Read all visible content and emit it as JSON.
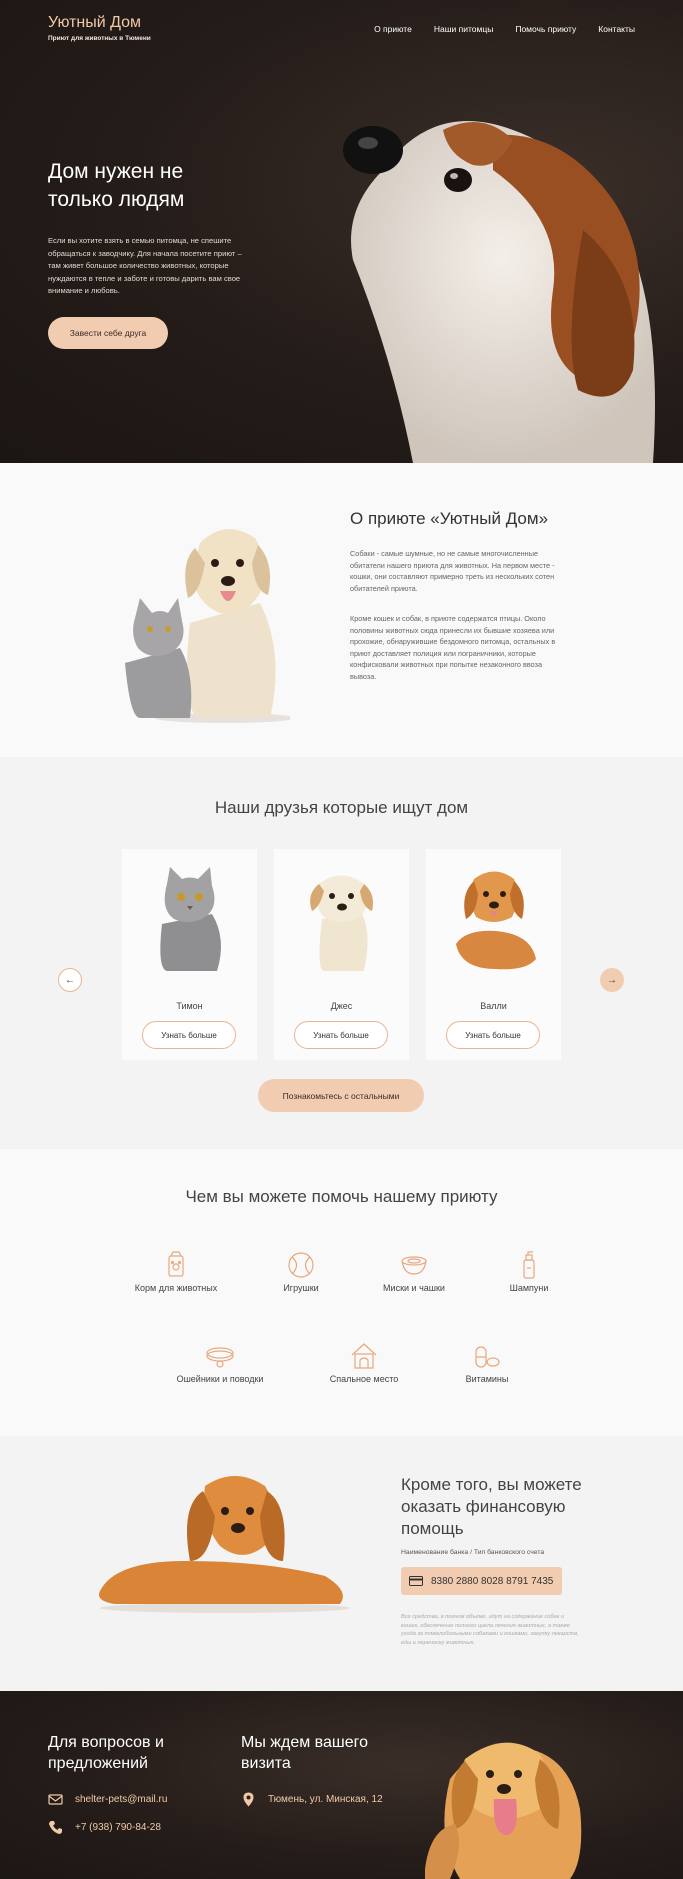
{
  "header": {
    "logo_title": "Уютный Дом",
    "logo_subtitle": "Приют для животных в Тюмени",
    "nav": [
      "О приюте",
      "Наши питомцы",
      "Помочь приюту",
      "Контакты"
    ]
  },
  "hero": {
    "title": "Дом нужен не только людям",
    "text": "Если вы хотите взять в семью питомца, не спешите обращаться к заводчику. Для начала посетите приют – там живет большое количество животных, которые нуждаются в тепле и заботе и готовы дарить вам свое внимание и любовь.",
    "cta": "Завести себе друга"
  },
  "about": {
    "title": "О приюте «Уютный Дом»",
    "p1": "Собаки - самые шумные, но не самые многочисленные обитатели нашего приюта для животных. На первом месте - кошки, они составляют примерно треть из нескольких сотен обитателей приюта.",
    "p2": "Кроме кошек и собак, в приюте содержатся птицы. Около половины животных сюда принесли их бывшие хозяева или прохожие, обнаружившие бездомного питомца, остальных в приют доставляет полиция или пограничники, которые конфисковали животных при попытке незаконного ввоза вывоза."
  },
  "friends": {
    "title": "Наши друзья которые ищут дом",
    "pets": [
      {
        "name": "Тимон",
        "button": "Узнать больше"
      },
      {
        "name": "Джес",
        "button": "Узнать больше"
      },
      {
        "name": "Валли",
        "button": "Узнать больше"
      }
    ],
    "prev": "←",
    "next": "→",
    "all_button": "Познакомьтесь с остальными"
  },
  "help": {
    "title": "Чем вы можете помочь нашему приюту",
    "items": [
      {
        "label": "Корм для животных",
        "icon": "pet-food-icon"
      },
      {
        "label": "Игрушки",
        "icon": "ball-icon"
      },
      {
        "label": "Миски и чашки",
        "icon": "bowl-icon"
      },
      {
        "label": "Шампуни",
        "icon": "shampoo-icon"
      },
      {
        "label": "Ошейники и поводки",
        "icon": "collar-icon"
      },
      {
        "label": "Спальное место",
        "icon": "pet-house-icon"
      },
      {
        "label": "Витамины",
        "icon": "vitamins-icon"
      }
    ]
  },
  "finance": {
    "title": "Кроме того, вы можете оказать финансовую помощь",
    "bank_label": "Наименование банка / Тип банковского счета",
    "account": "8380 2880 8028 8791 7435",
    "note": "Все средства, в полном объеме, идут на содержание собак и кошек, обеспечение полного цикла лечения животных, а также уходa за тяжелобольными собаками и кошками, закупку лекарств, еды и переноску животных."
  },
  "footer": {
    "questions_title": "Для вопросов и предложений",
    "visit_title": "Мы ждем вашего визита",
    "email": "shelter-pets@mail.ru",
    "phone": "+7 (938) 790-84-28",
    "address": "Тюмень, ул. Минская, 12"
  },
  "colors": {
    "accent": "#f1ccb1",
    "accent_text": "#f1c9a8",
    "dark_bg": "#241c19"
  }
}
